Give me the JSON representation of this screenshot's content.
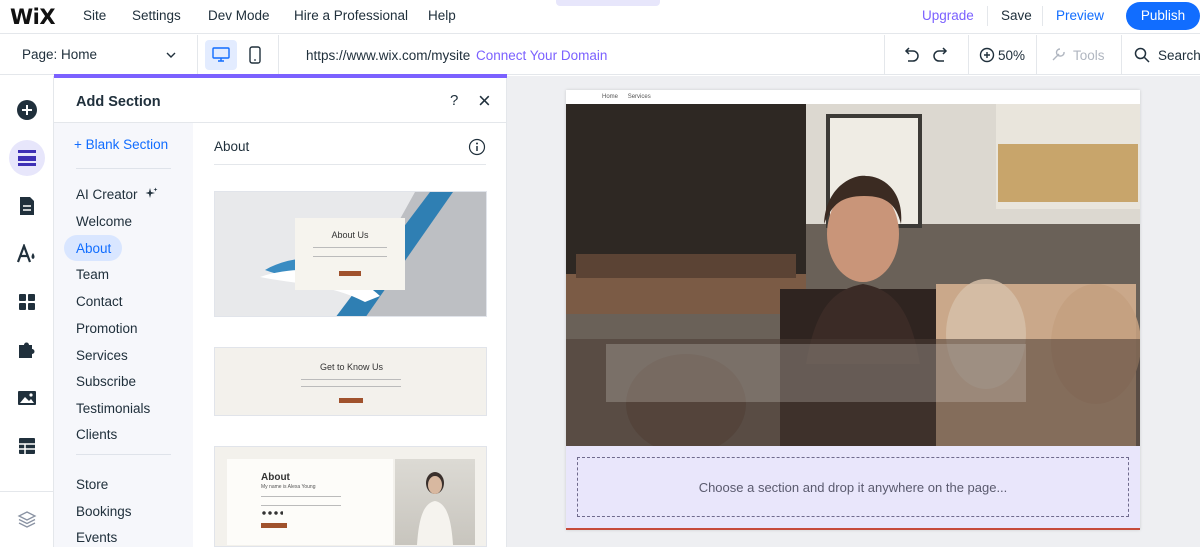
{
  "topbar": {
    "logo": "WiX",
    "menu": [
      "Site",
      "Settings",
      "Dev Mode",
      "Hire a Professional",
      "Help"
    ],
    "upgrade": "Upgrade",
    "save": "Save",
    "preview": "Preview",
    "publish": "Publish"
  },
  "toolbar": {
    "page_selector": "Page: Home",
    "url": "https://www.wix.com/mysite",
    "connect_domain": "Connect Your Domain",
    "zoom": "50%",
    "tools": "Tools",
    "search": "Search"
  },
  "panel": {
    "title": "Add Section",
    "help": "?",
    "close": "×",
    "blank_section": "+  Blank Section",
    "categories": [
      "AI Creator",
      "Welcome",
      "About",
      "Team",
      "Contact",
      "Promotion",
      "Services",
      "Subscribe",
      "Testimonials",
      "Clients"
    ],
    "categories_2": [
      "Store",
      "Bookings",
      "Events"
    ],
    "selected_category": "About",
    "content_title": "About",
    "thumbs": [
      {
        "title": "About Us"
      },
      {
        "title": "Get to Know Us"
      },
      {
        "title": "About",
        "subtitle": "My name is Alexa Young"
      }
    ]
  },
  "canvas": {
    "nav": [
      "Home",
      "Services"
    ],
    "drop_text": "Choose a section and drop it anywhere on the page..."
  },
  "colors": {
    "accent": "#116dff",
    "purple": "#7b61ff",
    "selected_bg": "#d9e6ff",
    "drop_zone": "#e9e6fb"
  },
  "icons": {
    "rail": [
      "add-icon",
      "sections-icon",
      "pages-icon",
      "theme-icon",
      "apps-icon",
      "puzzle-icon",
      "media-icon",
      "table-icon",
      "layers-icon"
    ]
  }
}
